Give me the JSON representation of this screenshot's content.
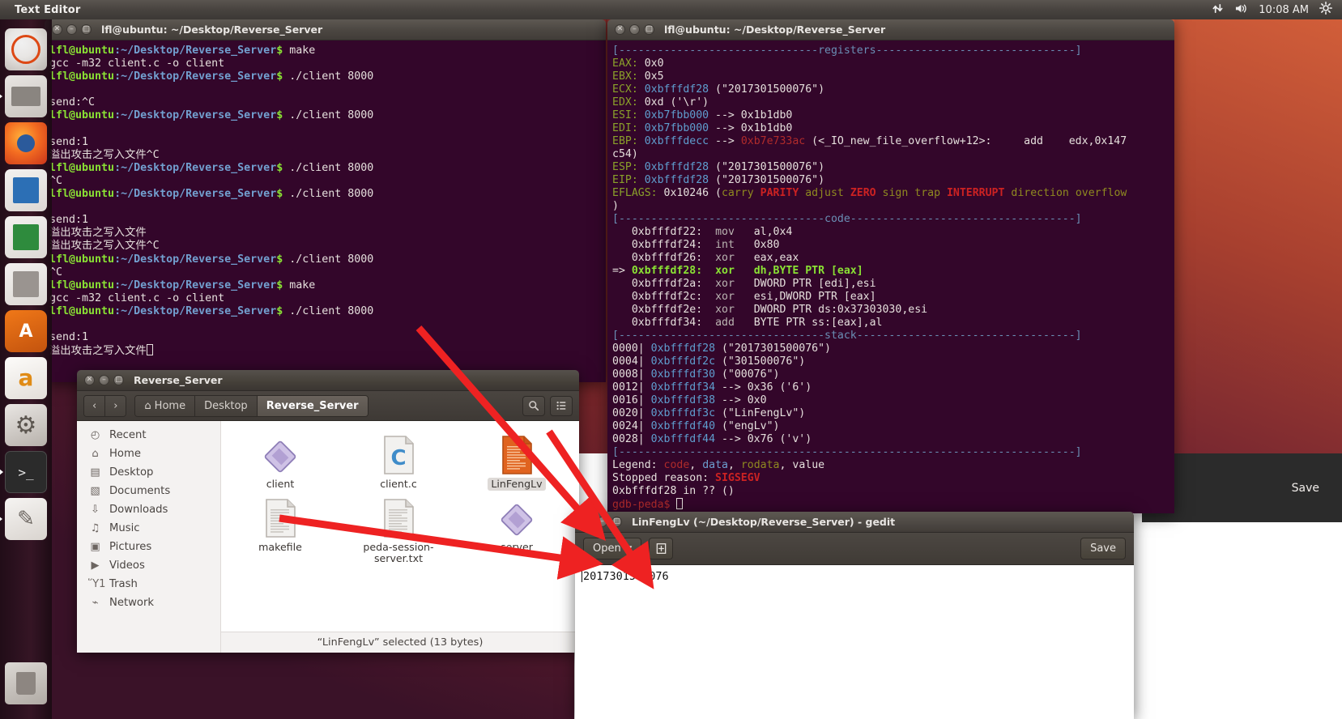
{
  "panel": {
    "app_title": "Text Editor",
    "clock": "10:08 AM",
    "icons": {
      "network": "network-icon",
      "volume": "volume-icon",
      "gear": "gear-icon"
    }
  },
  "launcher": {
    "items": [
      {
        "name": "ubuntu-dash",
        "label": "Ubuntu Dash"
      },
      {
        "name": "files",
        "label": "Files"
      },
      {
        "name": "firefox",
        "label": "Firefox"
      },
      {
        "name": "impress",
        "label": "LibreOffice Impress"
      },
      {
        "name": "calc",
        "label": "LibreOffice Calc"
      },
      {
        "name": "writer",
        "label": "LibreOffice Writer"
      },
      {
        "name": "software-center",
        "label": "Ubuntu Software"
      },
      {
        "name": "amazon",
        "label": "Amazon"
      },
      {
        "name": "settings",
        "label": "System Settings"
      },
      {
        "name": "terminal",
        "label": "Terminal"
      },
      {
        "name": "gedit",
        "label": "Text Editor"
      },
      {
        "name": "trash",
        "label": "Trash"
      }
    ]
  },
  "terminal_left": {
    "title": "lfl@ubuntu: ~/Desktop/Reverse_Server",
    "prompt_user": "lfl@ubuntu",
    "prompt_path": ":~/Desktop/Reverse_Server",
    "prompt_dollar": "$",
    "lines": [
      {
        "type": "prompt",
        "cmd": " make"
      },
      {
        "type": "out",
        "text": "gcc -m32 client.c -o client"
      },
      {
        "type": "prompt",
        "cmd": " ./client 8000"
      },
      {
        "type": "out",
        "text": ""
      },
      {
        "type": "out",
        "text": "send:^C"
      },
      {
        "type": "prompt",
        "cmd": " ./client 8000"
      },
      {
        "type": "out",
        "text": ""
      },
      {
        "type": "out",
        "text": "send:1"
      },
      {
        "type": "out",
        "text": "溢出攻击之写入文件^C"
      },
      {
        "type": "prompt",
        "cmd": " ./client 8000"
      },
      {
        "type": "out",
        "text": "^C"
      },
      {
        "type": "prompt",
        "cmd": " ./client 8000"
      },
      {
        "type": "out",
        "text": ""
      },
      {
        "type": "out",
        "text": "send:1"
      },
      {
        "type": "out",
        "text": "溢出攻击之写入文件"
      },
      {
        "type": "out",
        "text": "溢出攻击之写入文件^C"
      },
      {
        "type": "prompt",
        "cmd": " ./client 8000"
      },
      {
        "type": "out",
        "text": "^C"
      },
      {
        "type": "prompt",
        "cmd": " make"
      },
      {
        "type": "out",
        "text": "gcc -m32 client.c -o client"
      },
      {
        "type": "prompt",
        "cmd": " ./client 8000"
      },
      {
        "type": "out",
        "text": ""
      },
      {
        "type": "out",
        "text": "send:1"
      },
      {
        "type": "out_cursor",
        "text": "溢出攻击之写入文件"
      }
    ]
  },
  "terminal_right": {
    "title": "lfl@ubuntu: ~/Desktop/Reverse_Server",
    "registers_header": "[-------------------------------registers-------------------------------]",
    "code_header": "[--------------------------------code-----------------------------------]",
    "stack_header": "[--------------------------------stack----------------------------------]",
    "footer_sep": "[-----------------------------------------------------------------------]",
    "registers": [
      {
        "name": "EAX:",
        "value": "0x0"
      },
      {
        "name": "EBX:",
        "value": "0x5"
      },
      {
        "name": "ECX:",
        "addr": "0xbfffdf28",
        "extra": " (\"2017301500076\")"
      },
      {
        "name": "EDX:",
        "value": "0xd ('\\r')"
      },
      {
        "name": "ESI:",
        "addr": "0xb7fbb000",
        "extra": " --> 0x1b1db0"
      },
      {
        "name": "EDI:",
        "addr": "0xb7fbb000",
        "extra": " --> 0x1b1db0"
      },
      {
        "name": "EBP:",
        "addr": "0xbfffdecc",
        "arrow": " --> ",
        "red": "0xb7e733ac",
        "extra": " (<_IO_new_file_overflow+12>:\tadd    edx,0x147"
      },
      {
        "name": "",
        "value": "c54)"
      },
      {
        "name": "ESP:",
        "addr": "0xbfffdf28",
        "extra": " (\"2017301500076\")"
      },
      {
        "name": "EIP:",
        "addr": "0xbfffdf28",
        "extra": " (\"2017301500076\")"
      }
    ],
    "eflags_label": "EFLAGS:",
    "eflags_value": " 0x10246 (",
    "eflags_flags": [
      {
        "t": "carry",
        "hot": false
      },
      {
        "t": "PARITY",
        "hot": true
      },
      {
        "t": "adjust",
        "hot": false
      },
      {
        "t": "ZERO",
        "hot": true
      },
      {
        "t": "sign",
        "hot": false
      },
      {
        "t": "trap",
        "hot": false
      },
      {
        "t": "INTERRUPT",
        "hot": true
      },
      {
        "t": "direction",
        "hot": false
      },
      {
        "t": "overflow",
        "hot": false
      }
    ],
    "eflags_close": ")",
    "code": [
      {
        "marker": "   ",
        "addr": "0xbfffdf22:",
        "op": "mov",
        "args": "al,0x4",
        "current": false
      },
      {
        "marker": "   ",
        "addr": "0xbfffdf24:",
        "op": "int",
        "args": "0x80",
        "current": false
      },
      {
        "marker": "   ",
        "addr": "0xbfffdf26:",
        "op": "xor",
        "args": "eax,eax",
        "current": false
      },
      {
        "marker": "=> ",
        "addr": "0xbfffdf28:",
        "op": "xor",
        "args": "dh,BYTE PTR [eax]",
        "current": true
      },
      {
        "marker": "   ",
        "addr": "0xbfffdf2a:",
        "op": "xor",
        "args": "DWORD PTR [edi],esi",
        "current": false
      },
      {
        "marker": "   ",
        "addr": "0xbfffdf2c:",
        "op": "xor",
        "args": "esi,DWORD PTR [eax]",
        "current": false
      },
      {
        "marker": "   ",
        "addr": "0xbfffdf2e:",
        "op": "xor",
        "args": "DWORD PTR ds:0x37303030,esi",
        "current": false
      },
      {
        "marker": "   ",
        "addr": "0xbfffdf34:",
        "op": "add",
        "args": "BYTE PTR ss:[eax],al",
        "current": false
      }
    ],
    "stack": [
      {
        "off": "0000|",
        "addr": "0xbfffdf28",
        "rest": " (\"2017301500076\")"
      },
      {
        "off": "0004|",
        "addr": "0xbfffdf2c",
        "rest": " (\"301500076\")"
      },
      {
        "off": "0008|",
        "addr": "0xbfffdf30",
        "rest": " (\"00076\")"
      },
      {
        "off": "0012|",
        "addr": "0xbfffdf34",
        "rest": " --> 0x36 ('6')"
      },
      {
        "off": "0016|",
        "addr": "0xbfffdf38",
        "rest": " --> 0x0"
      },
      {
        "off": "0020|",
        "addr": "0xbfffdf3c",
        "rest": " (\"LinFengLv\")"
      },
      {
        "off": "0024|",
        "addr": "0xbfffdf40",
        "rest": " (\"engLv\")"
      },
      {
        "off": "0028|",
        "addr": "0xbfffdf44",
        "rest": " --> 0x76 ('v')"
      }
    ],
    "legend_label": "Legend: ",
    "legend_code": "code",
    "legend_data": "data",
    "legend_rodata": "rodata",
    "legend_value": "value",
    "stopped_label": "Stopped reason: ",
    "stopped_value": "SIGSEGV",
    "stopped_frame": "0xbfffdf28 in ?? ()",
    "gdb_prompt": "gdb-peda$"
  },
  "nautilus": {
    "title": "Reverse_Server",
    "nav": {
      "back": "‹",
      "forward": "›"
    },
    "breadcrumbs": [
      {
        "label": "Home",
        "icon": "home-icon",
        "active": false
      },
      {
        "label": "Desktop",
        "icon": "",
        "active": false
      },
      {
        "label": "Reverse_Server",
        "icon": "",
        "active": true
      }
    ],
    "toolbar_icons": [
      {
        "name": "search-icon",
        "glyph": "⌕"
      },
      {
        "name": "list-view-icon",
        "glyph": "☰"
      },
      {
        "name": "grid-view-icon",
        "glyph": "∷"
      }
    ],
    "sidebar": [
      {
        "label": "Recent",
        "icon": "clock-icon",
        "glyph": "◴"
      },
      {
        "label": "Home",
        "icon": "home-icon",
        "glyph": "⌂"
      },
      {
        "label": "Desktop",
        "icon": "folder-icon",
        "glyph": "▤"
      },
      {
        "label": "Documents",
        "icon": "document-icon",
        "glyph": "▧"
      },
      {
        "label": "Downloads",
        "icon": "download-icon",
        "glyph": "⇩"
      },
      {
        "label": "Music",
        "icon": "music-icon",
        "glyph": "♫"
      },
      {
        "label": "Pictures",
        "icon": "camera-icon",
        "glyph": "▣"
      },
      {
        "label": "Videos",
        "icon": "video-icon",
        "glyph": "▶"
      },
      {
        "label": "Trash",
        "icon": "trash-icon",
        "glyph": "Ὕ1"
      },
      {
        "label": "Network",
        "icon": "network-icon",
        "glyph": "⌁"
      }
    ],
    "files": [
      {
        "name": "client",
        "kind": "binary",
        "selected": false
      },
      {
        "name": "client.c",
        "kind": "csource",
        "selected": false
      },
      {
        "name": "LinFengLv",
        "kind": "textfile-orange",
        "selected": true
      },
      {
        "name": "makefile",
        "kind": "textfile",
        "selected": false
      },
      {
        "name": "peda-session-server.txt",
        "kind": "textfile",
        "selected": false
      },
      {
        "name": "server",
        "kind": "binary",
        "selected": false
      }
    ],
    "status": "“LinFengLv” selected  (13 bytes)"
  },
  "gedit": {
    "title": "LinFengLv (~/Desktop/Reverse_Server) - gedit",
    "open_label": "Open",
    "open_caret": "▾",
    "new_tab_icon": "new-document-icon",
    "save_label": "Save",
    "content": "2017301500076"
  },
  "desktop": {
    "save_ghost": "Save"
  },
  "colors": {
    "terminal_bg": "#33062a",
    "accent_orange": "#dd4814",
    "arrow_red": "#ee2222",
    "prompt_green": "#8ae234",
    "path_blue": "#729fcf"
  }
}
